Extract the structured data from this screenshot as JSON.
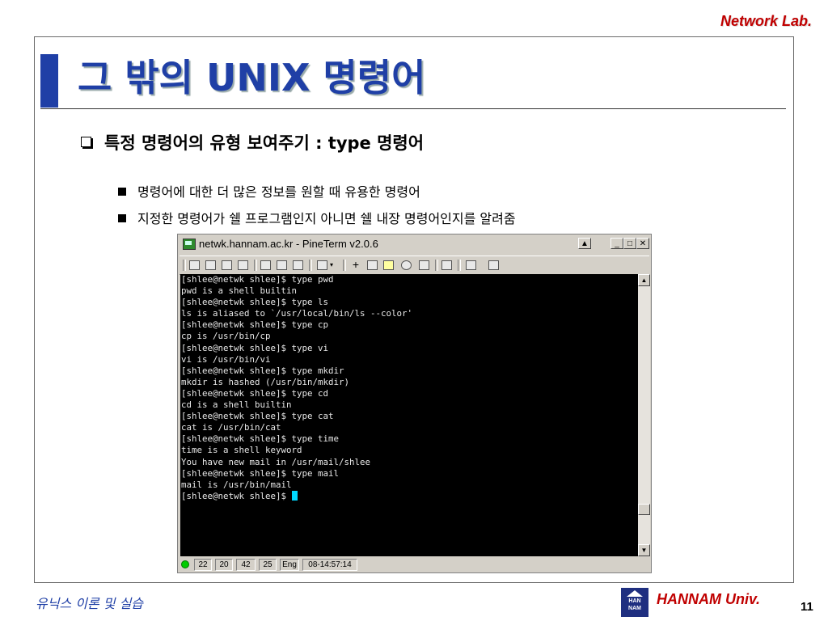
{
  "header": {
    "lab": "Network Lab."
  },
  "slide": {
    "title": "그 밖의 UNIX 명령어",
    "bullet": "특정 명령어의 유형 보여주기 : type 명령어",
    "subs": [
      "명령어에 대한 더 많은 정보를 원할 때 유용한 명령어",
      "지정한 명령어가 쉘 프로그램인지 아니면 쉘 내장 명령어인지를 알려줌"
    ]
  },
  "window": {
    "title": "netwk.hannam.ac.kr - PineTerm v2.0.6",
    "icons": {
      "app": "terminal-icon",
      "title_buttons": [
        "dropdown-icon",
        "minimize-icon",
        "maximize-icon",
        "close-icon"
      ],
      "toolbar": [
        "connect-icon",
        "copy-icon",
        "save-icon",
        "disconnect-icon",
        "cut-icon",
        "paste-icon",
        "print-icon",
        "list-icon",
        "dropdown-icon",
        "cross-icon",
        "settings-icon",
        "monitor-icon",
        "find-icon",
        "wrench-icon",
        "run-icon",
        "printer-icon",
        "tools-icon"
      ]
    },
    "terminal_lines": [
      "[shlee@netwk shlee]$ type pwd",
      "pwd is a shell builtin",
      "[shlee@netwk shlee]$ type ls",
      "ls is aliased to `/usr/local/bin/ls --color'",
      "[shlee@netwk shlee]$ type cp",
      "cp is /usr/bin/cp",
      "[shlee@netwk shlee]$ type vi",
      "vi is /usr/bin/vi",
      "[shlee@netwk shlee]$ type mkdir",
      "mkdir is hashed (/usr/bin/mkdir)",
      "[shlee@netwk shlee]$ type cd",
      "cd is a shell builtin",
      "[shlee@netwk shlee]$ type cat",
      "cat is /usr/bin/cat",
      "[shlee@netwk shlee]$ type time",
      "time is a shell keyword",
      "You have new mail in /usr/mail/shlee",
      "[shlee@netwk shlee]$ type mail",
      "mail is /usr/bin/mail"
    ],
    "prompt": "[shlee@netwk shlee]$ ",
    "status": {
      "a": "22",
      "b": "20",
      "c": "42",
      "d": "25",
      "lang": "Eng",
      "time": "08-14:57:14"
    }
  },
  "footer": {
    "course": "유닉스 이론 및 실습",
    "logo_text": [
      "HAN",
      "NAM"
    ],
    "univ": "HANNAM Univ.",
    "page": "11"
  },
  "colors": {
    "title": "#1f3fa6",
    "accent_red": "#c00000",
    "terminal_bg": "#000000",
    "cursor": "#00d8ff"
  }
}
